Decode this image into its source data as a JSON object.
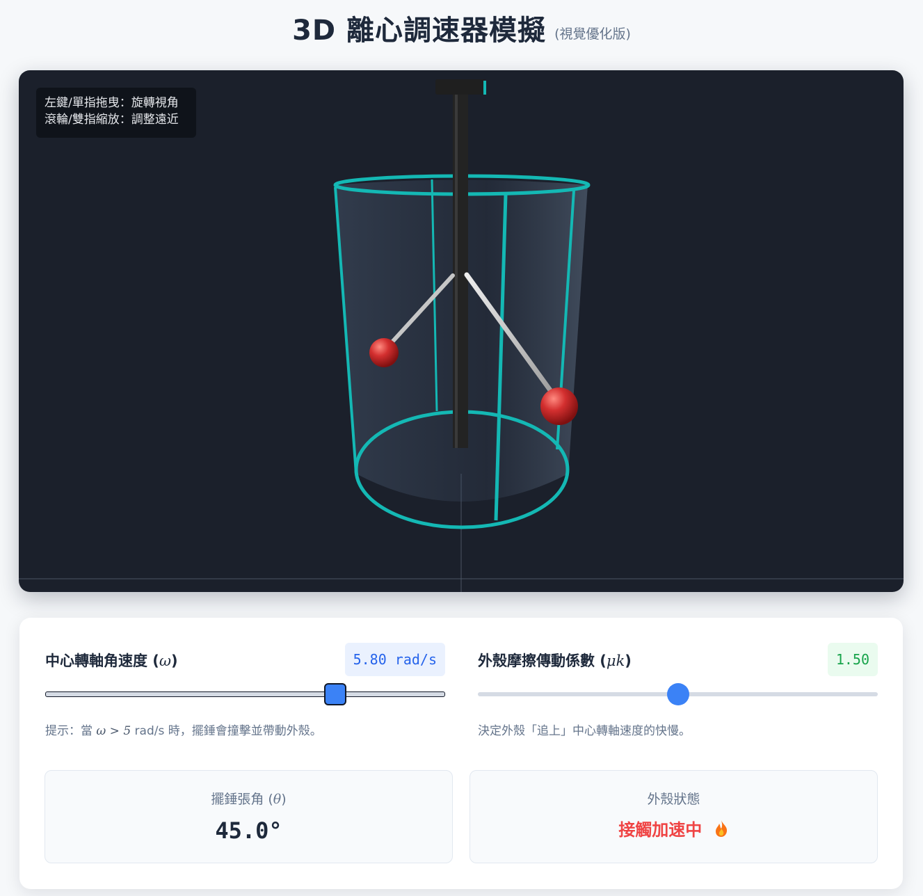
{
  "header": {
    "title": "3D 離心調速器模擬",
    "subtitle": "(視覺優化版)"
  },
  "viewport": {
    "help_line1": "左鍵/單指拖曳：旋轉視角",
    "help_line2": "滾輪/雙指縮放：調整遠近",
    "colors": {
      "background": "#1b202b",
      "cage": "#14b8b4",
      "shaft": "#222222",
      "ball": "#d32f2f",
      "rod": "#c8c8c8"
    }
  },
  "controls": {
    "omega": {
      "label": "中心轉軸角速度 (",
      "symbol": "ω",
      "label_end": ")",
      "value_text": "5.80 rad/s",
      "value": 5.8,
      "min": 0,
      "max": 8,
      "hint_prefix": "提示：當 ",
      "hint_math": "ω > 5",
      "hint_suffix": " rad/s 時，擺錘會撞擊並帶動外殼。"
    },
    "friction": {
      "label": "外殼摩擦傳動係數 (",
      "symbol": "μk",
      "label_end": ")",
      "value_text": "1.50",
      "value": 1.5,
      "min": 0,
      "max": 3,
      "hint": "決定外殼「追上」中心轉軸速度的快慢。"
    }
  },
  "stats": {
    "angle_label": "擺錘張角 (",
    "angle_symbol": "θ",
    "angle_label_end": ")",
    "angle_value": "45.0°",
    "shell_label": "外殼狀態",
    "shell_status": "接觸加速中",
    "shell_icon": "fire-icon",
    "status_color": "#ef4444"
  }
}
